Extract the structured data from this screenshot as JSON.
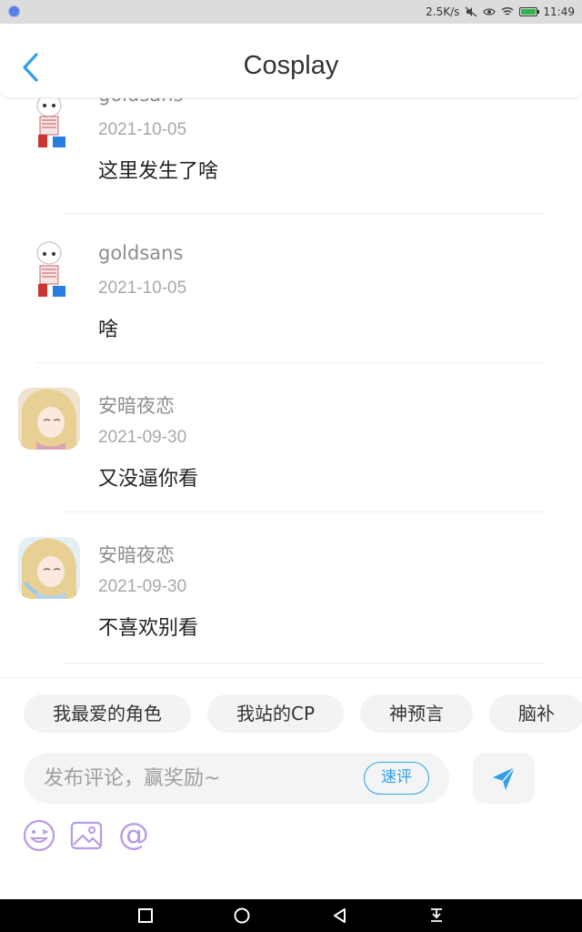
{
  "status_bar": {
    "speed": "2.5K/s",
    "time": "11:49"
  },
  "header": {
    "title": "Cosplay"
  },
  "comments": [
    {
      "username": "goldsans",
      "date": "2021-10-05",
      "text": "这里发生了啥"
    },
    {
      "username": "goldsans",
      "date": "2021-10-05",
      "text": "啥"
    },
    {
      "username": "安暗夜恋",
      "date": "2021-09-30",
      "text": "又没逼你看"
    },
    {
      "username": "安暗夜恋",
      "date": "2021-09-30",
      "text": "不喜欢别看"
    }
  ],
  "tags": [
    "我最爱的角色",
    "我站的CP",
    "神预言",
    "脑补"
  ],
  "composer": {
    "placeholder": "发布评论，赢奖励~",
    "quick_label": "速评",
    "at_symbol": "@"
  },
  "colors": {
    "accent": "#2fa0e8",
    "tool_purple": "#b79ae6",
    "battery": "#2fb44b"
  },
  "icons": [
    "back-arrow",
    "send-plane",
    "emoji",
    "image",
    "at",
    "nav-square",
    "nav-circle",
    "nav-triangle",
    "nav-down"
  ]
}
